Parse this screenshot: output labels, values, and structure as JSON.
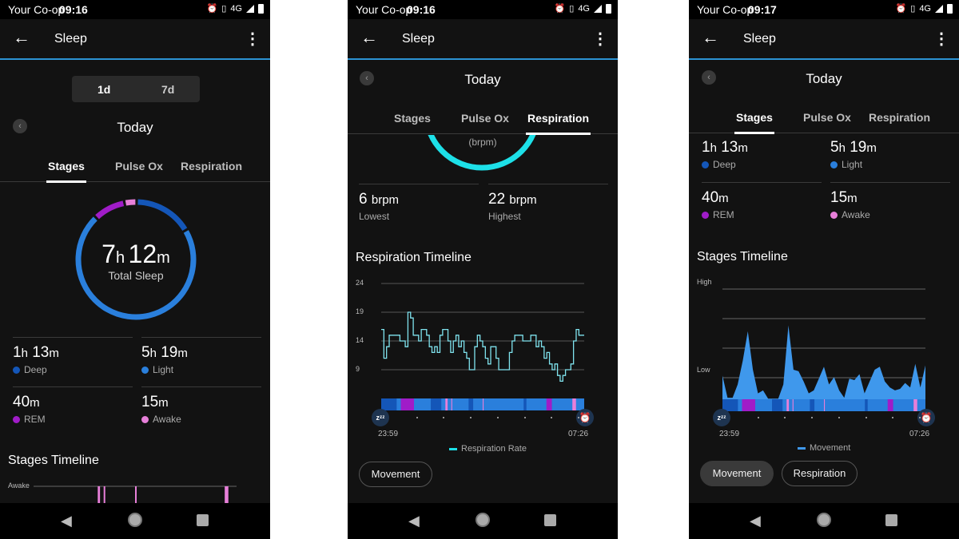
{
  "colors": {
    "deep": "#1456b8",
    "light": "#2a7fdc",
    "rem": "#a01cc8",
    "awake": "#e77fd9",
    "accent_line": "#2c93d3",
    "respiration": "#7fe3ee",
    "ring_resp": "#1de0e8",
    "movement": "#3f98ec"
  },
  "stage_segments": [
    {
      "stage": "deep",
      "minutes": 34
    },
    {
      "stage": "light",
      "minutes": 9
    },
    {
      "stage": "rem",
      "minutes": 29
    },
    {
      "stage": "light",
      "minutes": 37
    },
    {
      "stage": "deep",
      "minutes": 23
    },
    {
      "stage": "light",
      "minutes": 9
    },
    {
      "stage": "awake",
      "minutes": 5
    },
    {
      "stage": "light",
      "minutes": 8
    },
    {
      "stage": "awake",
      "minutes": 2
    },
    {
      "stage": "light",
      "minutes": 36
    },
    {
      "stage": "deep",
      "minutes": 10
    },
    {
      "stage": "light",
      "minutes": 21
    },
    {
      "stage": "awake",
      "minutes": 2
    },
    {
      "stage": "light",
      "minutes": 88
    },
    {
      "stage": "deep",
      "minutes": 6
    },
    {
      "stage": "light",
      "minutes": 44
    },
    {
      "stage": "rem",
      "minutes": 12
    },
    {
      "stage": "light",
      "minutes": 45
    },
    {
      "stage": "awake",
      "minutes": 8
    },
    {
      "stage": "light",
      "minutes": 18
    }
  ],
  "phone1": {
    "status": {
      "carrier": "Your Co-op",
      "time": "09:16",
      "network": "4G"
    },
    "title": "Sleep",
    "range_options": [
      "1d",
      "7d"
    ],
    "date": "Today",
    "tabs": [
      "Stages",
      "Pulse Ox",
      "Respiration"
    ],
    "active_tab": "Stages",
    "total": {
      "h": "7",
      "m": "12",
      "h_unit": "h",
      "m_unit": "m",
      "label": "Total Sleep"
    },
    "stats": [
      {
        "num1": "1",
        "u1": "h",
        "num2": "13",
        "u2": "m",
        "label": "Deep",
        "color": "#1456b8"
      },
      {
        "num1": "5",
        "u1": "h",
        "num2": "19",
        "u2": "m",
        "label": "Light",
        "color": "#2a7fdc"
      },
      {
        "num1": "",
        "u1": "",
        "num2": "40",
        "u2": "m",
        "label": "REM",
        "color": "#a01cc8"
      },
      {
        "num1": "",
        "u1": "",
        "num2": "15",
        "u2": "m",
        "label": "Awake",
        "color": "#e77fd9"
      }
    ],
    "ring_minutes": {
      "deep": 73,
      "light": 319,
      "rem": 40,
      "awake": 15
    },
    "section_title": "Stages Timeline",
    "axis_label": "Awake"
  },
  "phone2": {
    "status": {
      "carrier": "Your Co-op",
      "time": "09:16",
      "network": "4G"
    },
    "title": "Sleep",
    "date": "Today",
    "tabs": [
      "Stages",
      "Pulse Ox",
      "Respiration"
    ],
    "active_tab": "Respiration",
    "ring_unit": "(brpm)",
    "stats": [
      {
        "value": "6",
        "unit": "brpm",
        "label": "Lowest"
      },
      {
        "value": "22",
        "unit": "brpm",
        "label": "Highest"
      }
    ],
    "section_title": "Respiration Timeline",
    "chart_data": {
      "type": "line",
      "yticks": [
        24,
        19,
        14,
        9
      ],
      "ylim": [
        6,
        25
      ],
      "x_start": "23:59",
      "x_end": "07:26",
      "series": [
        {
          "name": "Respiration Rate",
          "values": [
            16,
            11,
            13,
            15,
            15,
            15,
            15,
            14,
            14,
            13,
            19,
            18,
            15,
            15,
            14,
            16,
            16,
            15,
            13,
            12,
            13,
            12,
            15,
            16,
            16,
            14,
            12,
            14,
            15,
            13,
            14,
            12,
            11,
            9,
            9,
            13,
            15,
            14,
            13,
            11,
            10,
            13,
            13,
            11,
            9,
            9,
            9,
            9,
            12,
            14,
            15,
            15,
            15,
            14,
            14,
            14,
            15,
            15,
            13,
            14,
            13,
            11,
            12,
            10,
            9,
            10,
            8,
            7,
            8,
            9,
            9,
            10,
            14,
            16,
            15,
            15,
            15
          ]
        }
      ]
    },
    "buttons": [
      "Movement"
    ]
  },
  "phone3": {
    "status": {
      "carrier": "Your Co-op",
      "time": "09:17",
      "network": "4G"
    },
    "title": "Sleep",
    "date": "Today",
    "tabs": [
      "Stages",
      "Pulse Ox",
      "Respiration"
    ],
    "active_tab": "Stages",
    "stats": [
      {
        "num1": "1",
        "u1": "h",
        "num2": "13",
        "u2": "m",
        "label": "Deep",
        "color": "#1456b8"
      },
      {
        "num1": "5",
        "u1": "h",
        "num2": "19",
        "u2": "m",
        "label": "Light",
        "color": "#2a7fdc"
      },
      {
        "num1": "",
        "u1": "",
        "num2": "40",
        "u2": "m",
        "label": "REM",
        "color": "#a01cc8"
      },
      {
        "num1": "",
        "u1": "",
        "num2": "15",
        "u2": "m",
        "label": "Awake",
        "color": "#e77fd9"
      }
    ],
    "section_title": "Stages Timeline",
    "chart_data": {
      "type": "area",
      "ylabels": [
        "High",
        "Low"
      ],
      "x_start": "23:59",
      "x_end": "07:26",
      "series": [
        {
          "name": "Movement",
          "values": [
            0.8,
            0.05,
            0.05,
            0.5,
            1.3,
            2.3,
            1.0,
            0.2,
            0.3,
            0.02,
            0.02,
            0.02,
            0.5,
            2.5,
            1.0,
            0.95,
            0.6,
            0.2,
            0.3,
            0.7,
            1.1,
            0.5,
            0.75,
            0.3,
            0.05,
            0.7,
            0.65,
            0.85,
            0.2,
            0.6,
            1.0,
            1.1,
            0.6,
            0.4,
            0.3,
            0.35,
            0.55,
            0.4,
            1.2,
            0.4,
            1.15
          ]
        }
      ]
    },
    "buttons": [
      "Movement",
      "Respiration"
    ]
  }
}
